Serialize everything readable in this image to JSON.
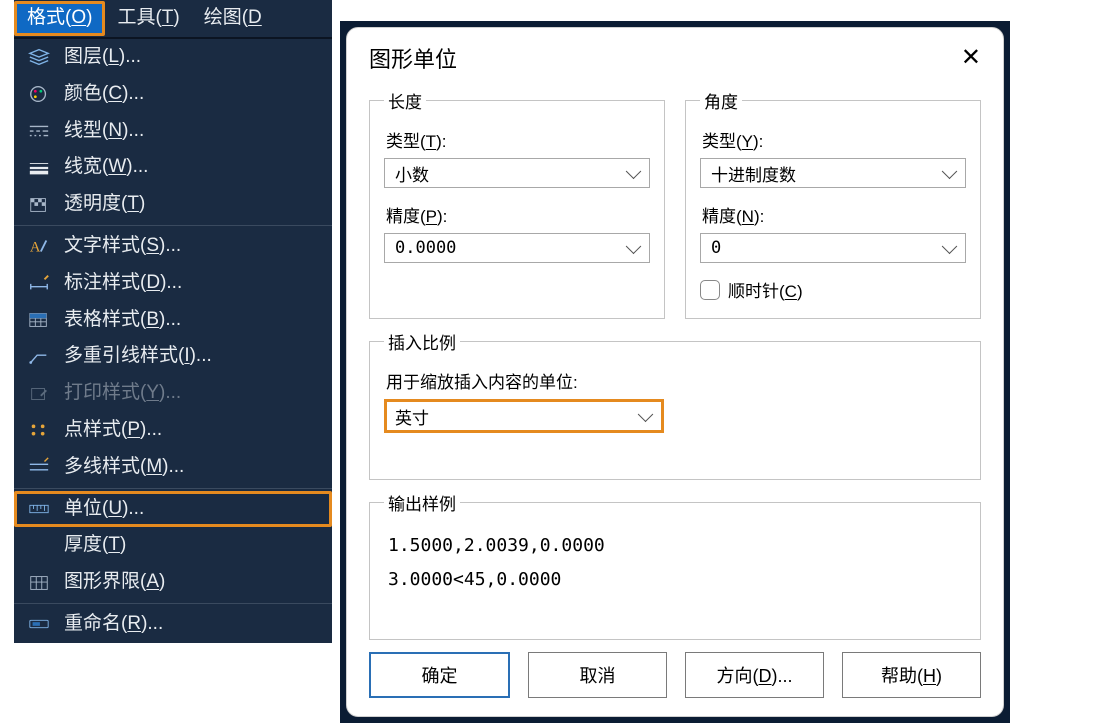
{
  "menubar": {
    "format": {
      "pre": "格式(",
      "u": "O",
      "post": ")"
    },
    "tools": {
      "pre": "工具(",
      "u": "T",
      "post": ")"
    },
    "draw": {
      "pre": "绘图(",
      "u": "D",
      "post": ""
    }
  },
  "menu_items": {
    "layer": {
      "pre": "图层(",
      "u": "L",
      "post": ")..."
    },
    "color": {
      "pre": "颜色(",
      "u": "C",
      "post": ")..."
    },
    "linetype": {
      "pre": "线型(",
      "u": "N",
      "post": ")..."
    },
    "lineweight": {
      "pre": "线宽(",
      "u": "W",
      "post": ")..."
    },
    "transparency": {
      "pre": "透明度(",
      "u": "T",
      "post": ")"
    },
    "textstyle": {
      "pre": "文字样式(",
      "u": "S",
      "post": ")..."
    },
    "dimstyle": {
      "pre": "标注样式(",
      "u": "D",
      "post": ")..."
    },
    "tablestyle": {
      "pre": "表格样式(",
      "u": "B",
      "post": ")..."
    },
    "mleaderstyle": {
      "pre": "多重引线样式(",
      "u": "I",
      "post": ")..."
    },
    "plotstyle": {
      "pre": "打印样式(",
      "u": "Y",
      "post": ")..."
    },
    "pointstyle": {
      "pre": "点样式(",
      "u": "P",
      "post": ")..."
    },
    "mlinestyle": {
      "pre": "多线样式(",
      "u": "M",
      "post": ")..."
    },
    "units": {
      "pre": "单位(",
      "u": "U",
      "post": ")..."
    },
    "thickness": {
      "pre": "厚度(",
      "u": "T",
      "post": ")"
    },
    "limits": {
      "pre": "图形界限(",
      "u": "A",
      "post": ")"
    },
    "rename": {
      "pre": "重命名(",
      "u": "R",
      "post": ")..."
    }
  },
  "dialog": {
    "title": "图形单位",
    "length": {
      "legend": "长度",
      "type_label_pre": "类型(",
      "type_label_u": "T",
      "type_label_post": "):",
      "type_value": "小数",
      "prec_label_pre": "精度(",
      "prec_label_u": "P",
      "prec_label_post": "):",
      "prec_value": "0.0000"
    },
    "angle": {
      "legend": "角度",
      "type_label_pre": "类型(",
      "type_label_u": "Y",
      "type_label_post": "):",
      "type_value": "十进制度数",
      "prec_label_pre": "精度(",
      "prec_label_u": "N",
      "prec_label_post": "):",
      "prec_value": "0",
      "clockwise_pre": "顺时针(",
      "clockwise_u": "C",
      "clockwise_post": ")"
    },
    "insert": {
      "legend": "插入比例",
      "desc": "用于缩放插入内容的单位:",
      "value": "英寸"
    },
    "sample": {
      "legend": "输出样例",
      "line1": "1.5000,2.0039,0.0000",
      "line2": "3.0000<45,0.0000"
    },
    "buttons": {
      "ok": "确定",
      "cancel": "取消",
      "direction_pre": "方向(",
      "direction_u": "D",
      "direction_post": ")...",
      "help_pre": "帮助(",
      "help_u": "H",
      "help_post": ")"
    }
  }
}
